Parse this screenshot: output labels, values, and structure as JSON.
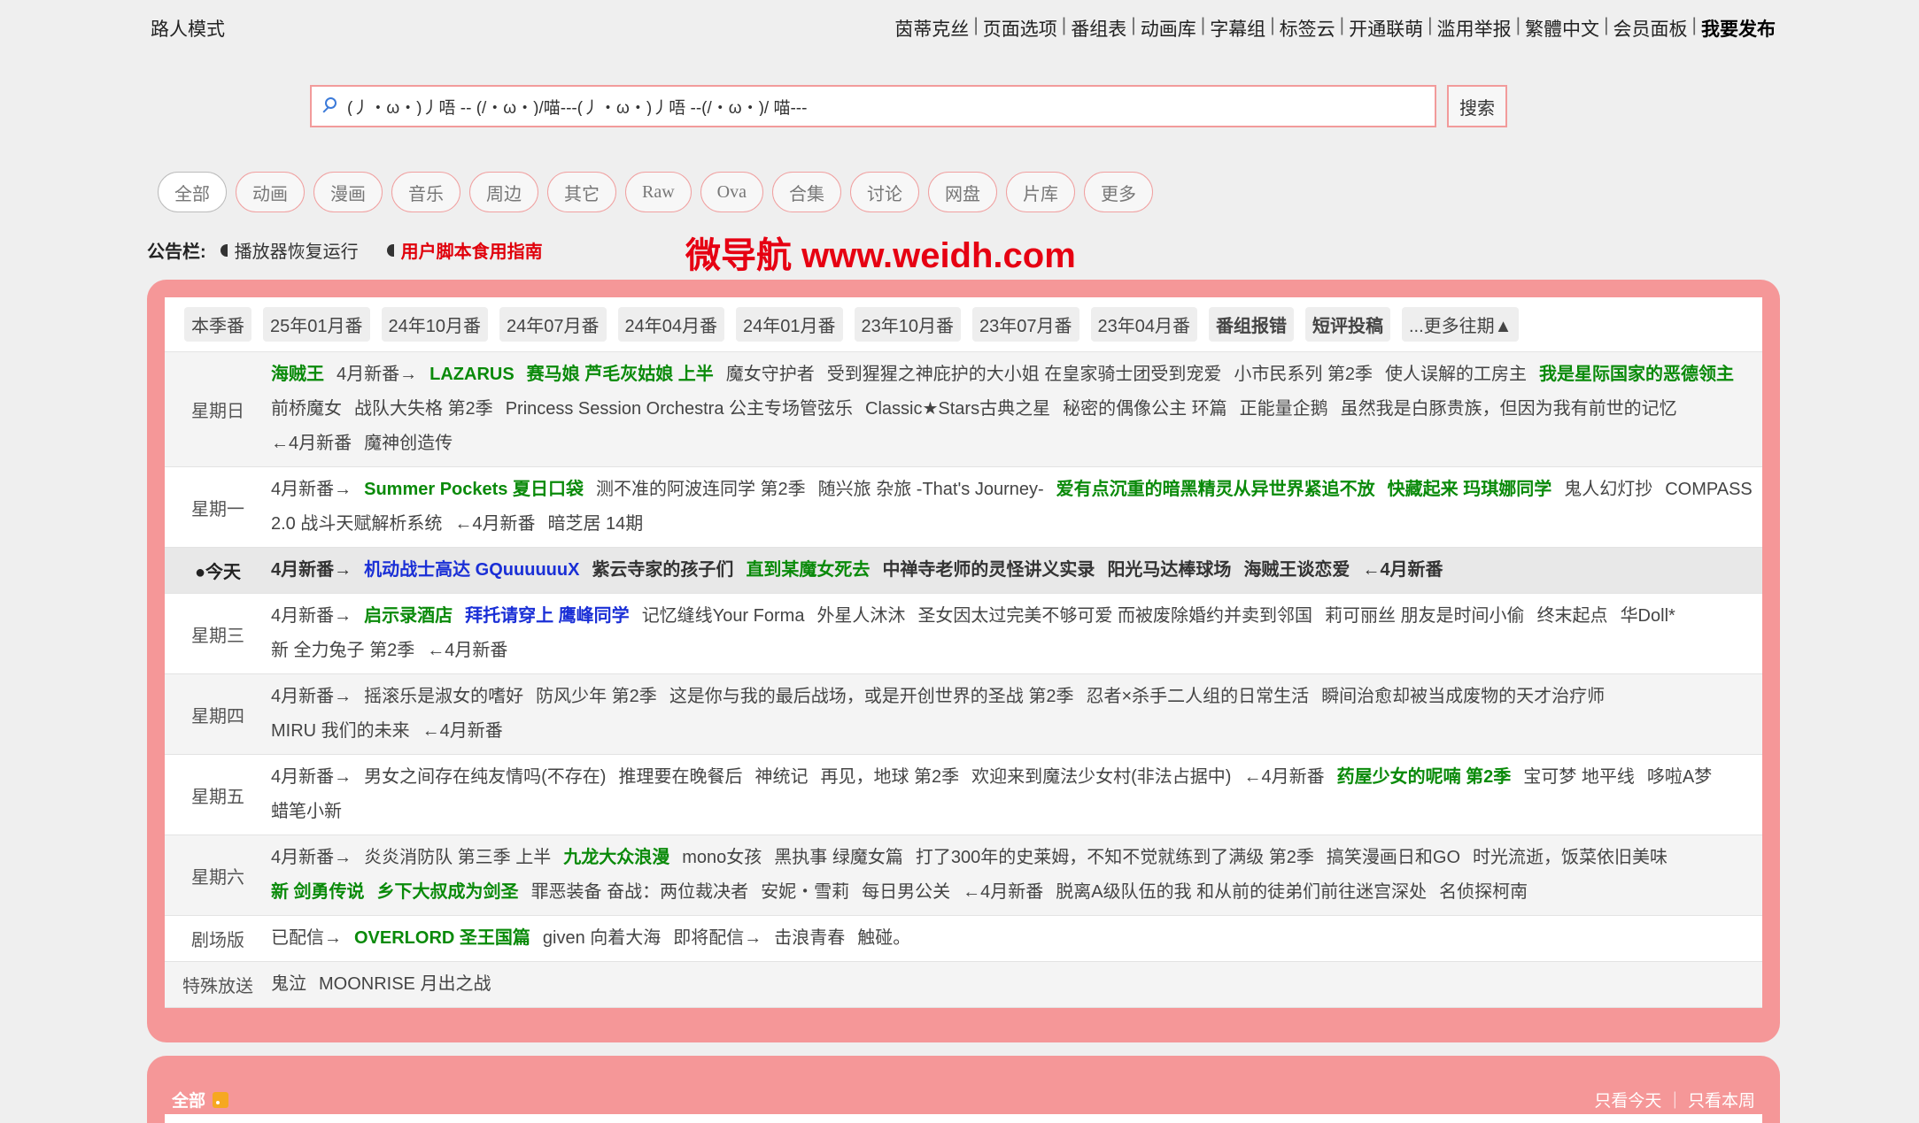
{
  "topbar": {
    "mode": "路人模式",
    "nav": [
      "茵蒂克丝",
      "页面选项",
      "番组表",
      "动画库",
      "字幕组",
      "标签云",
      "开通联萌",
      "滥用举报",
      "繁體中文",
      "会员面板",
      "我要发布"
    ]
  },
  "search": {
    "value": "(丿・ω・)丿唔 -- (/・ω・)/喵---(丿・ω・)丿唔 --(/・ω・)/ 喵---",
    "button": "搜索",
    "icon": "search-icon"
  },
  "categories": [
    "全部",
    "动画",
    "漫画",
    "音乐",
    "周边",
    "其它",
    "Raw",
    "Ova",
    "合集",
    "讨论",
    "网盘",
    "片库",
    "更多"
  ],
  "notice": {
    "label": "公告栏:",
    "items": [
      "播放器恢复运行",
      "用户脚本食用指南"
    ],
    "watermark": "微导航 www.weidh.com"
  },
  "schedule": {
    "seasons": [
      "本季番",
      "25年01月番",
      "24年10月番",
      "24年07月番",
      "24年04月番",
      "24年01月番",
      "23年10月番",
      "23年07月番",
      "23年04月番",
      "番组报错",
      "短评投稿",
      "...更多往期▲"
    ],
    "days": [
      {
        "day": "星期日",
        "items": [
          {
            "t": "海贼王",
            "c": "g"
          },
          {
            "t": "4月新番→",
            "c": ""
          },
          {
            "t": "LAZARUS",
            "c": "g"
          },
          {
            "t": "赛马娘 芦毛灰姑娘 上半",
            "c": "g"
          },
          {
            "t": "魔女守护者",
            "c": ""
          },
          {
            "t": "受到猩猩之神庇护的大小姐 在皇家骑士团受到宠爱",
            "c": ""
          },
          {
            "t": "小市民系列 第2季",
            "c": ""
          },
          {
            "t": "使人误解的工房主",
            "c": ""
          },
          {
            "t": "我是星际国家的恶德领主",
            "c": "g"
          },
          {
            "t": "前桥魔女",
            "c": ""
          },
          {
            "t": "战队大失格 第2季",
            "c": ""
          },
          {
            "t": "Princess Session Orchestra 公主专场管弦乐",
            "c": ""
          },
          {
            "t": "Classic★Stars古典之星",
            "c": ""
          },
          {
            "t": "秘密的偶像公主 环篇",
            "c": ""
          },
          {
            "t": "正能量企鹅",
            "c": ""
          },
          {
            "t": "虽然我是白豚贵族，但因为我有前世的记忆",
            "c": ""
          },
          {
            "t": "←4月新番",
            "c": ""
          },
          {
            "t": "魔神创造传",
            "c": ""
          }
        ]
      },
      {
        "day": "星期一",
        "items": [
          {
            "t": "4月新番→",
            "c": ""
          },
          {
            "t": "Summer Pockets 夏日口袋",
            "c": "g"
          },
          {
            "t": "测不准的阿波连同学 第2季",
            "c": ""
          },
          {
            "t": "随兴旅 杂旅 -That's Journey-",
            "c": ""
          },
          {
            "t": "爱有点沉重的暗黑精灵从异世界紧追不放",
            "c": "g"
          },
          {
            "t": "快藏起来 玛琪娜同学",
            "c": "g"
          },
          {
            "t": "鬼人幻灯抄",
            "c": ""
          },
          {
            "t": "COMPASS 2.0 战斗天赋解析系统",
            "c": ""
          },
          {
            "t": "←4月新番",
            "c": ""
          },
          {
            "t": "暗芝居 14期",
            "c": ""
          }
        ]
      },
      {
        "day": "●今天",
        "items": [
          {
            "t": "4月新番→",
            "c": ""
          },
          {
            "t": "机动战士高达 GQuuuuuuX",
            "c": "b"
          },
          {
            "t": "紫云寺家的孩子们",
            "c": ""
          },
          {
            "t": "直到某魔女死去",
            "c": "g"
          },
          {
            "t": "中禅寺老师的灵怪讲义实录",
            "c": ""
          },
          {
            "t": "阳光马达棒球场",
            "c": ""
          },
          {
            "t": "海贼王谈恋爱",
            "c": ""
          },
          {
            "t": "←4月新番",
            "c": ""
          }
        ]
      },
      {
        "day": "星期三",
        "items": [
          {
            "t": "4月新番→",
            "c": ""
          },
          {
            "t": "启示录酒店",
            "c": "g"
          },
          {
            "t": "拜托请穿上 鹰峰同学",
            "c": "b"
          },
          {
            "t": "记忆缝线Your Forma",
            "c": ""
          },
          {
            "t": "外星人沐沐",
            "c": ""
          },
          {
            "t": "圣女因太过完美不够可爱 而被废除婚约并卖到邻国",
            "c": ""
          },
          {
            "t": "莉可丽丝 朋友是时间小偷",
            "c": ""
          },
          {
            "t": "终末起点",
            "c": ""
          },
          {
            "t": "华Doll*",
            "c": ""
          },
          {
            "t": "新 全力兔子 第2季",
            "c": ""
          },
          {
            "t": "←4月新番",
            "c": ""
          }
        ]
      },
      {
        "day": "星期四",
        "items": [
          {
            "t": "4月新番→",
            "c": ""
          },
          {
            "t": "摇滚乐是淑女的嗜好",
            "c": ""
          },
          {
            "t": "防风少年 第2季",
            "c": ""
          },
          {
            "t": "这是你与我的最后战场，或是开创世界的圣战 第2季",
            "c": ""
          },
          {
            "t": "忍者×杀手二人组的日常生活",
            "c": ""
          },
          {
            "t": "瞬间治愈却被当成废物的天才治疗师",
            "c": ""
          },
          {
            "t": "MIRU 我们的未来",
            "c": ""
          },
          {
            "t": "←4月新番",
            "c": ""
          }
        ]
      },
      {
        "day": "星期五",
        "items": [
          {
            "t": "4月新番→",
            "c": ""
          },
          {
            "t": "男女之间存在纯友情吗(不存在)",
            "c": ""
          },
          {
            "t": "推理要在晚餐后",
            "c": ""
          },
          {
            "t": "神统记",
            "c": ""
          },
          {
            "t": "再见，地球 第2季",
            "c": ""
          },
          {
            "t": "欢迎来到魔法少女村(非法占据中)",
            "c": ""
          },
          {
            "t": "←4月新番",
            "c": ""
          },
          {
            "t": "药屋少女的呢喃 第2季",
            "c": "g"
          },
          {
            "t": "宝可梦 地平线",
            "c": ""
          },
          {
            "t": "哆啦A梦",
            "c": ""
          },
          {
            "t": "蜡笔小新",
            "c": ""
          }
        ]
      },
      {
        "day": "星期六",
        "items": [
          {
            "t": "4月新番→",
            "c": ""
          },
          {
            "t": "炎炎消防队 第三季 上半",
            "c": ""
          },
          {
            "t": "九龙大众浪漫",
            "c": "g"
          },
          {
            "t": "mono女孩",
            "c": ""
          },
          {
            "t": "黑执事 绿魔女篇",
            "c": ""
          },
          {
            "t": "打了300年的史莱姆，不知不觉就练到了满级 第2季",
            "c": ""
          },
          {
            "t": "搞笑漫画日和GO",
            "c": ""
          },
          {
            "t": "时光流逝，饭菜依旧美味",
            "c": ""
          },
          {
            "t": "新 剑勇传说",
            "c": "g"
          },
          {
            "t": "乡下大叔成为剑圣",
            "c": "g"
          },
          {
            "t": "罪恶装备 奋战：两位裁决者",
            "c": ""
          },
          {
            "t": "安妮・雪莉",
            "c": ""
          },
          {
            "t": "每日男公关",
            "c": ""
          },
          {
            "t": "←4月新番",
            "c": ""
          },
          {
            "t": "脱离A级队伍的我 和从前的徒弟们前往迷宫深处",
            "c": ""
          },
          {
            "t": "名侦探柯南",
            "c": ""
          }
        ]
      },
      {
        "day": "剧场版",
        "items": [
          {
            "t": "已配信→",
            "c": ""
          },
          {
            "t": "OVERLORD 圣王国篇",
            "c": "g"
          },
          {
            "t": "given 向着大海",
            "c": ""
          },
          {
            "t": "即将配信→",
            "c": ""
          },
          {
            "t": "击浪青春",
            "c": ""
          },
          {
            "t": "触碰。",
            "c": ""
          }
        ]
      },
      {
        "day": "特殊放送",
        "items": [
          {
            "t": "鬼泣",
            "c": ""
          },
          {
            "t": "MOONRISE 月出之战",
            "c": ""
          }
        ]
      }
    ]
  },
  "bottom": {
    "all": "全部",
    "rss_icon": "rss-icon",
    "links": [
      "只看今天",
      "只看本周"
    ]
  },
  "colors": {
    "accent": "#f59798",
    "green": "#0a8a0a",
    "blue": "#1a2fd6",
    "red": "#e0000b"
  }
}
